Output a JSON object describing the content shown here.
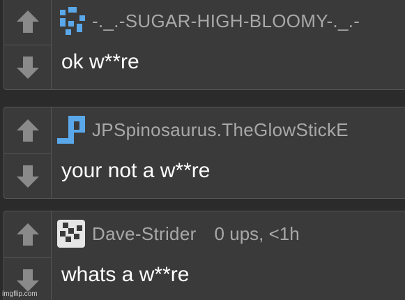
{
  "comments": [
    {
      "username": "-._.-SUGAR-HIGH-BLOOMY-._.-",
      "text": "ok w**re",
      "avatar_color": "#5aa8ea",
      "avatar_icon": "pixel-avatar-icon"
    },
    {
      "username": "JPSpinosaurus.TheGlowStickE",
      "text": "your not a w**re",
      "avatar_color": "#5aa8ea",
      "avatar_icon": "pixel-avatar-icon"
    },
    {
      "username": "Dave-Strider",
      "meta": "0 ups, <1h",
      "text": "whats a w**re",
      "avatar_color": "#e6e6e6",
      "avatar_icon": "pixel-avatar-icon"
    }
  ],
  "watermark": "imgflip.com",
  "colors": {
    "background": "#2b2b2b",
    "card": "#3a3a3a",
    "border": "#555555",
    "arrow": "#8a8a8a",
    "username": "#a8a8a8",
    "text": "#ffffff"
  }
}
